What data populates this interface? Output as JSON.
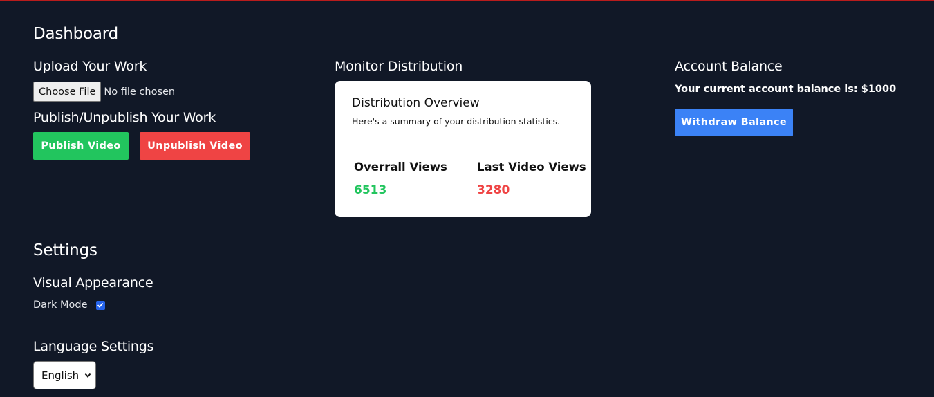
{
  "dashboard": {
    "title": "Dashboard",
    "upload": {
      "heading": "Upload Your Work",
      "choose_file_label": "Choose File",
      "file_status": "No file chosen"
    },
    "publish": {
      "heading": "Publish/Unpublish Your Work",
      "publish_label": "Publish Video",
      "unpublish_label": "Unpublish Video"
    },
    "monitor": {
      "heading": "Monitor Distribution",
      "card": {
        "title": "Distribution Overview",
        "subtitle": "Here's a summary of your distribution statistics.",
        "stats": [
          {
            "label": "Overrall Views",
            "value": "6513",
            "color": "#22c55e"
          },
          {
            "label": "Last Video Views",
            "value": "3280",
            "color": "#ef4444"
          }
        ]
      }
    },
    "balance": {
      "heading": "Account Balance",
      "text": "Your current account balance is: $1000",
      "withdraw_label": "Withdraw Balance"
    }
  },
  "settings": {
    "title": "Settings",
    "visual": {
      "heading": "Visual Appearance",
      "dark_mode_label": "Dark Mode",
      "dark_mode_checked": true
    },
    "language": {
      "heading": "Language Settings",
      "selected": "English"
    }
  },
  "colors": {
    "background": "#111827",
    "publish": "#22c55e",
    "unpublish": "#ef4444",
    "withdraw": "#3b82f6",
    "accent_line": "#b91c1c"
  }
}
